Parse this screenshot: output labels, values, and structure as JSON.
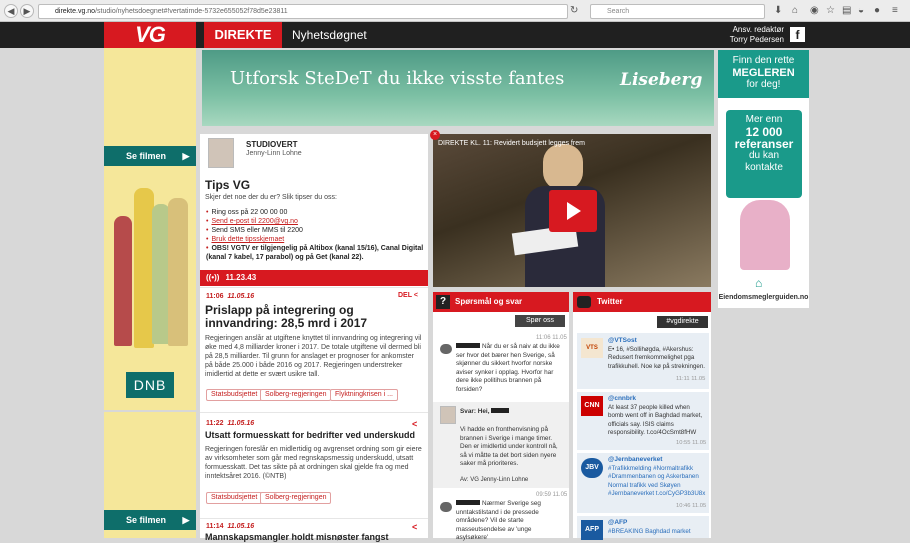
{
  "browser": {
    "url_host": "direkte.vg.no",
    "url_path": "/studio/nyhetsdoegnet#!vertatimde-5732e655052f78d5e23811",
    "search_placeholder": "Search"
  },
  "header": {
    "logo": "VG",
    "section": "DIREKTE",
    "subsection": "Nyhetsdøgnet",
    "editor_line1": "Ansv. redaktør",
    "editor_line2": "Torry Pedersen",
    "fb_label": "f"
  },
  "left_ad": {
    "button_top": "Se filmen",
    "button_bottom": "Se filmen",
    "brand": "DNB"
  },
  "banner": {
    "text": "Utforsk SteDeT du ikke visste fantes",
    "brand": "Liseberg"
  },
  "right_ad": {
    "top_line1": "Finn den rette",
    "top_line2": "MEGLEREN",
    "top_line3": "for deg!",
    "mid_line1": "Mer enn",
    "mid_line2": "12 000",
    "mid_line3": "referanser",
    "mid_line4": "du kan",
    "mid_line5": "kontakte",
    "brand": "Eiendomsmeglerguiden.no"
  },
  "studio": {
    "role": "STUDIOVERT",
    "name": "Jenny-Linn Lohne",
    "tips_title": "Tips VG",
    "tips_intro": "Skjer det noe der du er? Slik tipser du oss:",
    "tips": [
      {
        "text": "Ring oss på 22 00 00 00",
        "link": false
      },
      {
        "text": "Send e-post til 2200@vg.no",
        "link": true
      },
      {
        "text": "Send SMS eller MMS til 2200",
        "link": false
      },
      {
        "text": "Bruk dette tipsskjemaet",
        "link": true
      }
    ],
    "tv_note": "OBS! VGTV er tilgjengelig på Altibox (kanal 15/16), Canal Digital (kanal 7 kabel, 17 parabol) og på Get (kanal 22)."
  },
  "live": {
    "time": "11.23.43",
    "icon": "live-broadcast-icon"
  },
  "articles": [
    {
      "time": "11:06",
      "date": "11.05.16",
      "share_label": "DEL",
      "title": "Prislapp på integrering og innvandring: 28,5 mrd i 2017",
      "body": "Regjeringen anslår at utgiftene knyttet til innvandring og integrering vil øke med 4,8 milliarder kroner i 2017. De totale utgiftene vil dermed bli på 28,5 milliarder. Til grunn for anslaget er prognoser for ankomster på både 25.000 i både 2016 og 2017. Regjeringen understreker imidlertid at dette er svært usikre tall.",
      "tags": [
        "Statsbudsjettet",
        "Solberg-regjeringen",
        "Flyktningkrisen i ..."
      ]
    },
    {
      "time": "11:22",
      "date": "11.05.16",
      "share_label": "",
      "title": "Utsatt formuesskatt for bedrifter ved underskudd",
      "body": "Regjeringen foreslår en midlertidig og avgrenset ordning som gir eiere av virksomheter som går med regnskapsmessig underskudd, utsatt formuesskatt. Det tas sikte på at ordningen skal gjelde fra og med inntektsåret 2016. (©NTB)",
      "tags": [
        "Statsbudsjettet",
        "Solberg-regjeringen"
      ]
    },
    {
      "time": "11:14",
      "date": "11.05.16",
      "share_label": "",
      "title": "Mannskapsmangler holdt misnøster fangst",
      "body": "",
      "tags": []
    }
  ],
  "video": {
    "title": "DIREKTE KL. 11: Revidert budsjett legges frem",
    "close": "×"
  },
  "qa": {
    "title": "Spørsmål og svar",
    "ask_button": "Spør oss",
    "items": [
      {
        "time": "11:06 11.05",
        "question": "Når du er så naiv at du ikke ser hvor det bærer hen Sverige, så skjønner du sikkert hvorfor norske aviser synker i opplag. Hvorfor har dere ikke politihus brannen på forsiden?"
      },
      {
        "answer_label": "Svar: Hei,",
        "answer": "Vi hadde en fronthenvisning på brannen i Sverige i mange timer. Den er imidlertid under kontroll nå, så vi måtte ta det bort siden nyere saker må prioriteres.",
        "signature": "Av: VG Jenny-Linn Lohne"
      },
      {
        "time": "09:59 11.05",
        "question": "Nærmer Sverige seg unntakstilstand i de pressede områdene? Vil de starte masseutsendelse av 'unge asylsøkere'"
      }
    ]
  },
  "twitter": {
    "title": "Twitter",
    "hashtag_button": "#vgdirekte",
    "tweets": [
      {
        "handle": "@VTSost",
        "logo": "VTS",
        "text": "E• 16, #Sollihøgda, #Akershus: Redusert fremkommelighet pga trafikkuhell. Noe kø på strekningen.",
        "time": "11:11 11.05",
        "color": "#f0f0f0"
      },
      {
        "handle": "@cnnbrk",
        "logo": "CNN",
        "text": "At least 37 people killed when bomb went off in Baghdad market, officials say. ISIS claims responsibility. t.co/4OcSmt8fHW",
        "time": "10:55 11.05",
        "color": "#cc0000"
      },
      {
        "handle": "@Jernbaneverket",
        "logo": "JBV",
        "text": "#Trafikkmelding #Normaltrafikk #Drammenbanen og Askerbanen Normal trafikk ved Skøyen #Jernbaneverket t.co/CyGP3b3U8x",
        "time": "10:46 11.05",
        "color": "#1a5aa0"
      },
      {
        "handle": "@AFP",
        "logo": "AFP",
        "text": "#BREAKING Baghdad market",
        "time": "",
        "color": "#1a5aa0"
      }
    ]
  }
}
